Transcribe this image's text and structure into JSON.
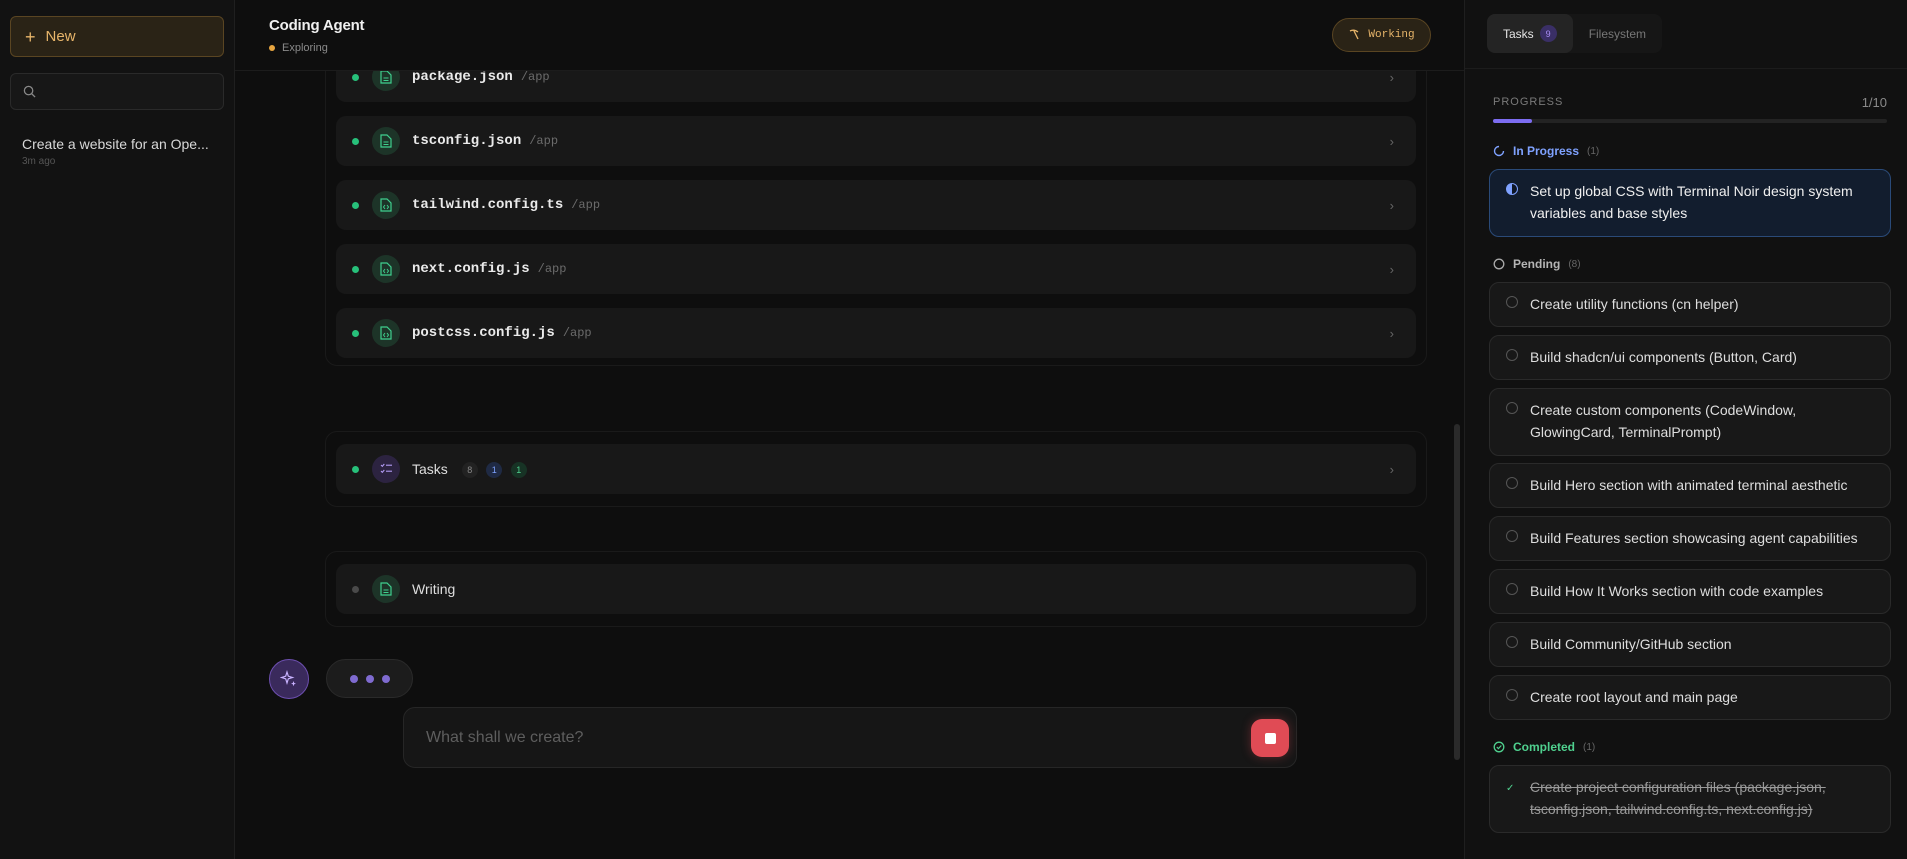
{
  "sidebar": {
    "new_label": "New",
    "search_placeholder": "",
    "conversations": [
      {
        "title": "Create a website for an Ope...",
        "time": "3m ago"
      }
    ]
  },
  "header": {
    "title": "Coding Agent",
    "status": "Exploring",
    "working_label": "Working"
  },
  "files": [
    {
      "name": "package.json",
      "path": "/app"
    },
    {
      "name": "tsconfig.json",
      "path": "/app"
    },
    {
      "name": "tailwind.config.ts",
      "path": "/app"
    },
    {
      "name": "next.config.js",
      "path": "/app"
    },
    {
      "name": "postcss.config.js",
      "path": "/app"
    }
  ],
  "tasks_row": {
    "label": "Tasks",
    "pending": "8",
    "in_progress": "1",
    "completed": "1"
  },
  "writing_row": {
    "label": "Writing"
  },
  "composer": {
    "placeholder": "What shall we create?"
  },
  "panel": {
    "tabs": [
      {
        "label": "Tasks",
        "count": "9"
      },
      {
        "label": "Filesystem"
      }
    ],
    "progress_label": "PROGRESS",
    "progress_count": "1/10",
    "progress_value": 0.1,
    "in_progress": {
      "label": "In Progress",
      "count": "(1)",
      "items": [
        "Set up global CSS with Terminal Noir design system variables and base styles"
      ]
    },
    "pending": {
      "label": "Pending",
      "count": "(8)",
      "items": [
        "Create utility functions (cn helper)",
        "Build shadcn/ui components (Button, Card)",
        "Create custom components (CodeWindow, GlowingCard, TerminalPrompt)",
        "Build Hero section with animated terminal aesthetic",
        "Build Features section showcasing agent capabilities",
        "Build How It Works section with code examples",
        "Build Community/GitHub section",
        "Create root layout and main page"
      ]
    },
    "completed": {
      "label": "Completed",
      "count": "(1)",
      "items": [
        "Create project configuration files (package.json, tsconfig.json, tailwind.config.ts, next.config.js)"
      ]
    }
  },
  "colors": {
    "accent_amber": "#e7b56a",
    "accent_purple": "#7c6cf0",
    "status_green": "#27c07a",
    "in_progress_blue": "#7fa2ff",
    "completed_green": "#4fd08e",
    "stop_red": "#e04b55"
  }
}
